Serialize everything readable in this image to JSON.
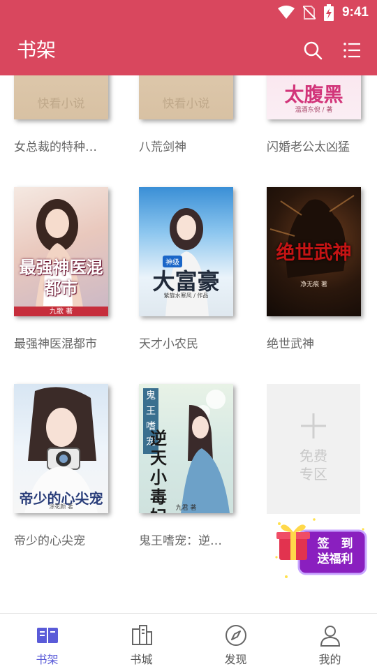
{
  "status": {
    "time": "9:41"
  },
  "appbar": {
    "title": "书架"
  },
  "books": [
    {
      "title": "女总裁的特种…",
      "cover_text": "快看小说"
    },
    {
      "title": "八荒剑神",
      "cover_text": "快看小说"
    },
    {
      "title": "闪婚老公太凶猛",
      "cover_text": "太腹黑",
      "cover_author": "温酒东倪 / 著"
    },
    {
      "title": "最强神医混都市",
      "cover_text": "最强神医混都市",
      "cover_author": "九歌 著"
    },
    {
      "title": "天才小农民",
      "cover_text": "大富豪",
      "cover_badge": "神级",
      "cover_author": "紫旋水寒风 / 作品"
    },
    {
      "title": "绝世武神",
      "cover_text": "绝世武神",
      "cover_author": "净无痕 著"
    },
    {
      "title": "帝少的心尖宠",
      "cover_text": "帝少的心尖宠",
      "cover_author": "涂花颜 著"
    },
    {
      "title": "鬼王嗜宠：逆…",
      "cover_text": "逆天小毒妃",
      "cover_side": "鬼王嗜宠",
      "cover_author": "九君 著"
    }
  ],
  "free_zone": {
    "line1": "免费",
    "line2": "专区"
  },
  "signin": {
    "line1": "签　到",
    "line2": "送福利"
  },
  "nav": [
    {
      "label": "书架",
      "icon": "bookshelf-icon",
      "active": true
    },
    {
      "label": "书城",
      "icon": "bookstore-icon",
      "active": false
    },
    {
      "label": "发现",
      "icon": "compass-icon",
      "active": false
    },
    {
      "label": "我的",
      "icon": "profile-icon",
      "active": false
    }
  ],
  "colors": {
    "primary": "#d9475e",
    "nav_active": "#5a5bd8"
  }
}
